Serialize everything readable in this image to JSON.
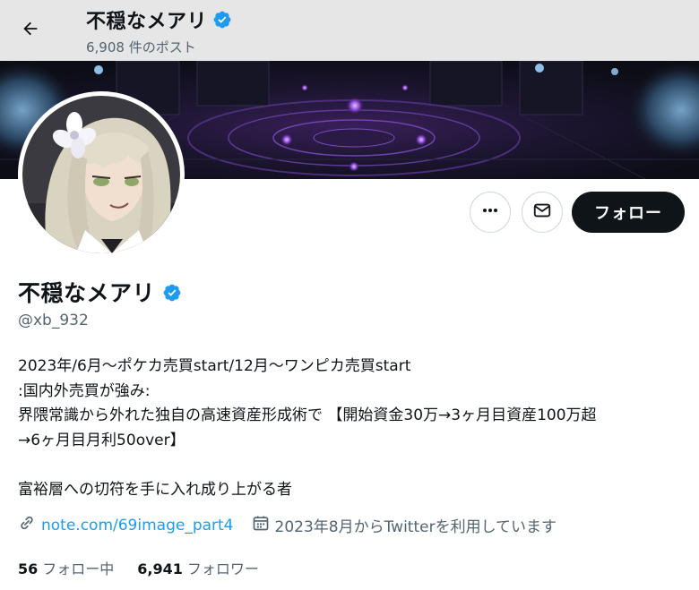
{
  "header": {
    "title": "不穏なメアリ",
    "post_count": "6,908 件のポスト",
    "back_icon": "arrow-left-icon"
  },
  "profile": {
    "display_name": "不穏なメアリ",
    "handle": "@xb_932",
    "verified": true,
    "bio_lines": [
      "2023年/6月～ポケカ売買start/12月～ワンピカ売買start",
      ":国内外売買が強み:",
      "界隈常識から外れた独自の高速資産形成術で 【開始資金30万→3ヶ月目資産100万超",
      "→6ヶ月目月利50over】",
      "",
      "富裕層への切符を手に入れ成り上がる者"
    ],
    "link": "note.com/69image_part4",
    "joined": "2023年8月からTwitterを利用しています"
  },
  "actions": {
    "more_icon": "more-dots-icon",
    "dm_icon": "envelope-icon",
    "follow_label": "フォロー"
  },
  "stats": {
    "following_count": "56",
    "following_label": "フォロー中",
    "followers_count": "6,941",
    "followers_label": "フォロワー"
  },
  "colors": {
    "accent": "#1d9bf0",
    "text_primary": "#0f1419",
    "text_secondary": "#536471",
    "follow_bg": "#0f1419"
  }
}
